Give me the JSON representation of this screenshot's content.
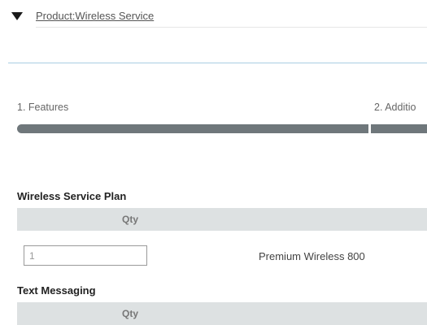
{
  "product": {
    "link_text": "Product:Wireless Service"
  },
  "steps": [
    {
      "label": "1. Features"
    },
    {
      "label": "2. Additio"
    }
  ],
  "sections": [
    {
      "title": "Wireless Service Plan",
      "column_header": "Qty",
      "rows": [
        {
          "qty": "1",
          "name": "Premium Wireless 800"
        }
      ]
    },
    {
      "title": "Text Messaging",
      "column_header": "Qty"
    }
  ]
}
